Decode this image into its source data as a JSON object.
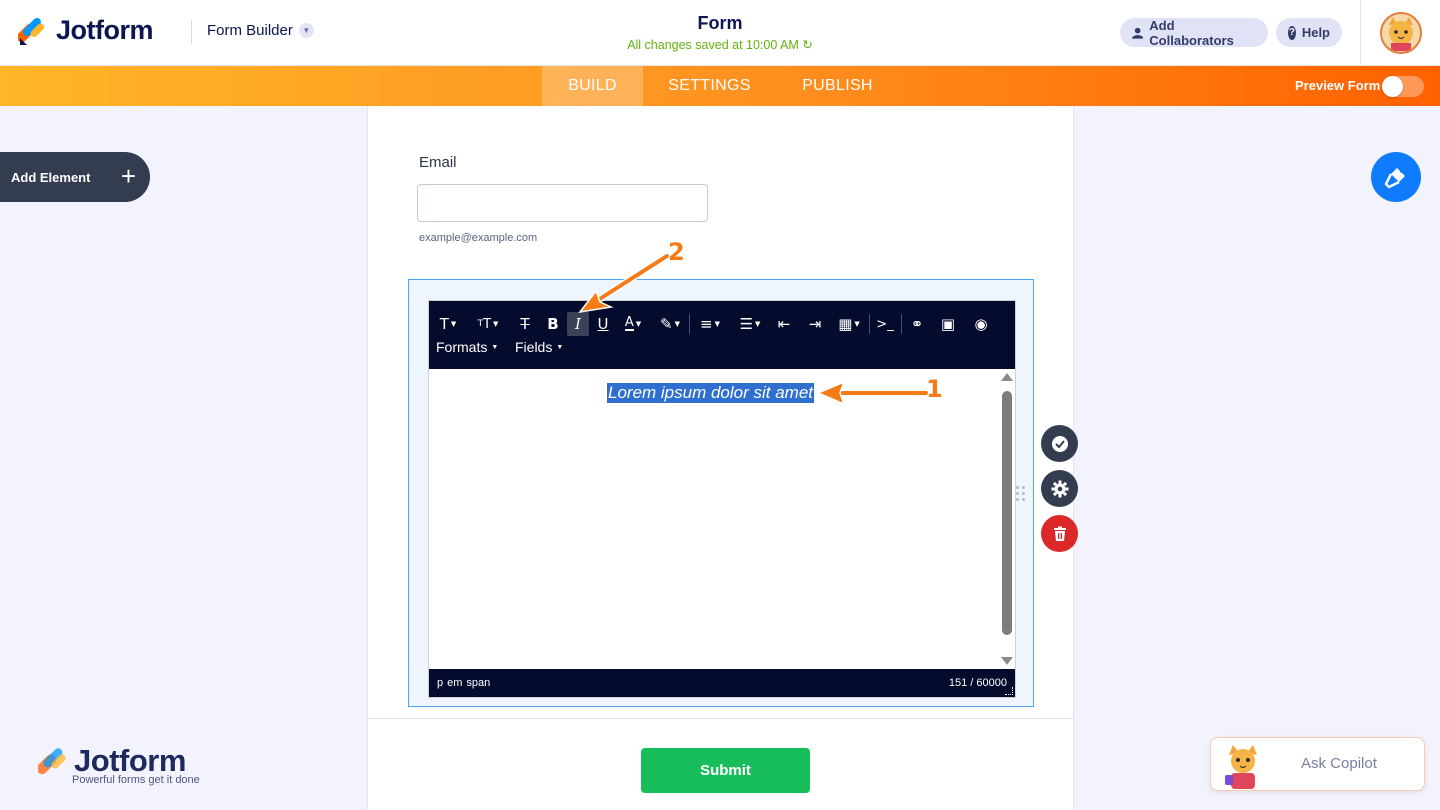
{
  "header": {
    "logo_text": "Jotform",
    "builder_label": "Form Builder",
    "form_title": "Form",
    "save_status": "All changes saved at 10:00 AM",
    "collaborators_label": "Add Collaborators",
    "help_label": "Help"
  },
  "nav": {
    "tabs": [
      {
        "label": "BUILD",
        "active": true
      },
      {
        "label": "SETTINGS",
        "active": false
      },
      {
        "label": "PUBLISH",
        "active": false
      }
    ],
    "preview_label": "Preview Form",
    "preview_enabled": false
  },
  "left_panel": {
    "add_element_label": "Add Element"
  },
  "form": {
    "email_label": "Email",
    "email_value": "",
    "email_sublabel": "example@example.com",
    "submit_label": "Submit"
  },
  "editor": {
    "toolbar_menus": {
      "formats": "Formats",
      "fields": "Fields"
    },
    "selected_text": "Lorem ipsum dolor sit amet",
    "path": [
      "p",
      "em",
      "span"
    ],
    "char_count": "151 / 60000",
    "active_button": "italic"
  },
  "watermark": {
    "logo_text": "Jotform",
    "tagline": "Powerful forms get it done"
  },
  "copilot": {
    "label": "Ask Copilot"
  },
  "annotations": {
    "marker_1": "1",
    "marker_2": "2"
  },
  "colors": {
    "accent_orange": "#ff8f1f",
    "brand_navy": "#0a1551",
    "submit_green": "#18bd5b",
    "delete_red": "#dc2828",
    "designer_blue": "#0f7cff",
    "selection_blue": "#2f6fd0",
    "saved_green": "#64b20f"
  }
}
